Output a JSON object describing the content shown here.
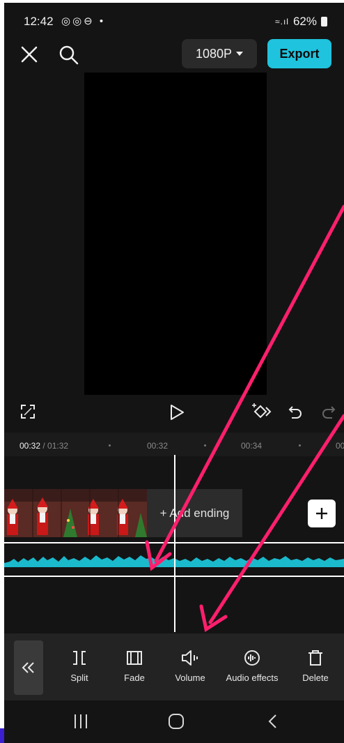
{
  "status_bar": {
    "time": "12:42",
    "notification_icons": "◎◎⊖ •",
    "network": "≈.ıl",
    "battery_percent": "62%"
  },
  "top_bar": {
    "resolution": "1080P",
    "export_label": "Export"
  },
  "timeline": {
    "current_time": "00:32",
    "total_time": "/ 01:32",
    "ticks": [
      "00:32",
      "00:34",
      "00"
    ]
  },
  "track": {
    "add_ending_label": "+ Add ending"
  },
  "toolbar": {
    "items": [
      {
        "label": "Split",
        "icon": "split-icon"
      },
      {
        "label": "Fade",
        "icon": "fade-icon"
      },
      {
        "label": "Volume",
        "icon": "volume-icon"
      },
      {
        "label": "Audio effects",
        "icon": "audio-effects-icon"
      },
      {
        "label": "Delete",
        "icon": "delete-icon"
      }
    ]
  },
  "colors": {
    "accent": "#1fc3dd",
    "waveform": "#1bb9cc",
    "annotation_arrow": "#ff1f6d"
  }
}
